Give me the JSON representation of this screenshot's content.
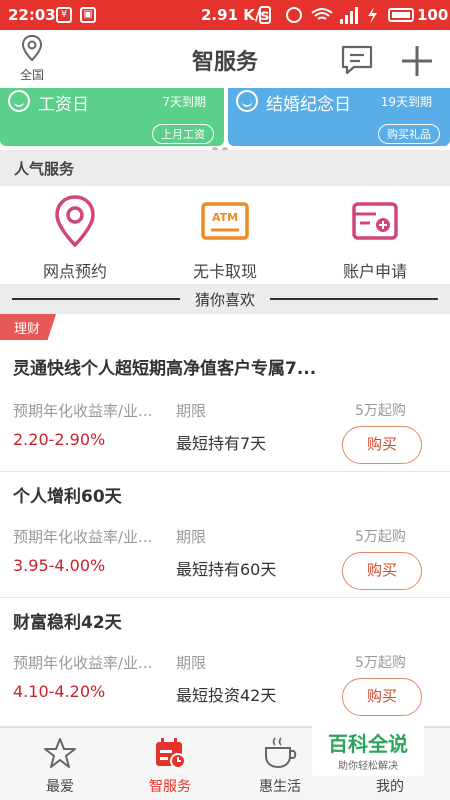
{
  "status_bar": {
    "time": "22:03",
    "speed": "2.91 K/s",
    "battery": "100"
  },
  "header": {
    "location_label": "全国",
    "title": "智服务"
  },
  "banner": [
    {
      "name": "工资日",
      "days": "7天到期",
      "button": "上月工资"
    },
    {
      "name": "结婚纪念日",
      "days": "19天到期",
      "button": "购买礼品"
    }
  ],
  "popular": {
    "title": "人气服务",
    "items": [
      {
        "label": "网点预约",
        "icon": "location-pin-icon"
      },
      {
        "label": "无卡取现",
        "icon": "atm-icon"
      },
      {
        "label": "账户申请",
        "icon": "account-card-icon"
      }
    ]
  },
  "guess_title": "猜你喜欢",
  "tag": "理财",
  "products": [
    {
      "name": "灵通快线个人超短期高净值客户专属7...",
      "rate_label": "预期年化收益率/业...",
      "term_label": "期限",
      "minimum": "5万起购",
      "rate": "2.20-2.90%",
      "term": "最短持有7天",
      "button": "购买"
    },
    {
      "name": "个人增利60天",
      "rate_label": "预期年化收益率/业...",
      "term_label": "期限",
      "minimum": "5万起购",
      "rate": "3.95-4.00%",
      "term": "最短持有60天",
      "button": "购买"
    },
    {
      "name": "财富稳利42天",
      "rate_label": "预期年化收益率/业...",
      "term_label": "期限",
      "minimum": "5万起购",
      "rate": "4.10-4.20%",
      "term": "最短投资42天",
      "button": "购买"
    }
  ],
  "bottom_nav": [
    {
      "label": "最爱",
      "icon": "star-icon"
    },
    {
      "label": "智服务",
      "icon": "calendar-service-icon",
      "active": true
    },
    {
      "label": "惠生活",
      "icon": "coffee-cup-icon"
    },
    {
      "label": "我的",
      "icon": "person-icon"
    }
  ],
  "watermark": {
    "title": "百科全说",
    "subtitle": "助你轻松解决"
  },
  "colors": {
    "brand_red": "#e5322d",
    "green_card": "#5bd08a",
    "blue_card": "#5aaee8",
    "rate_red": "#c8232b"
  }
}
